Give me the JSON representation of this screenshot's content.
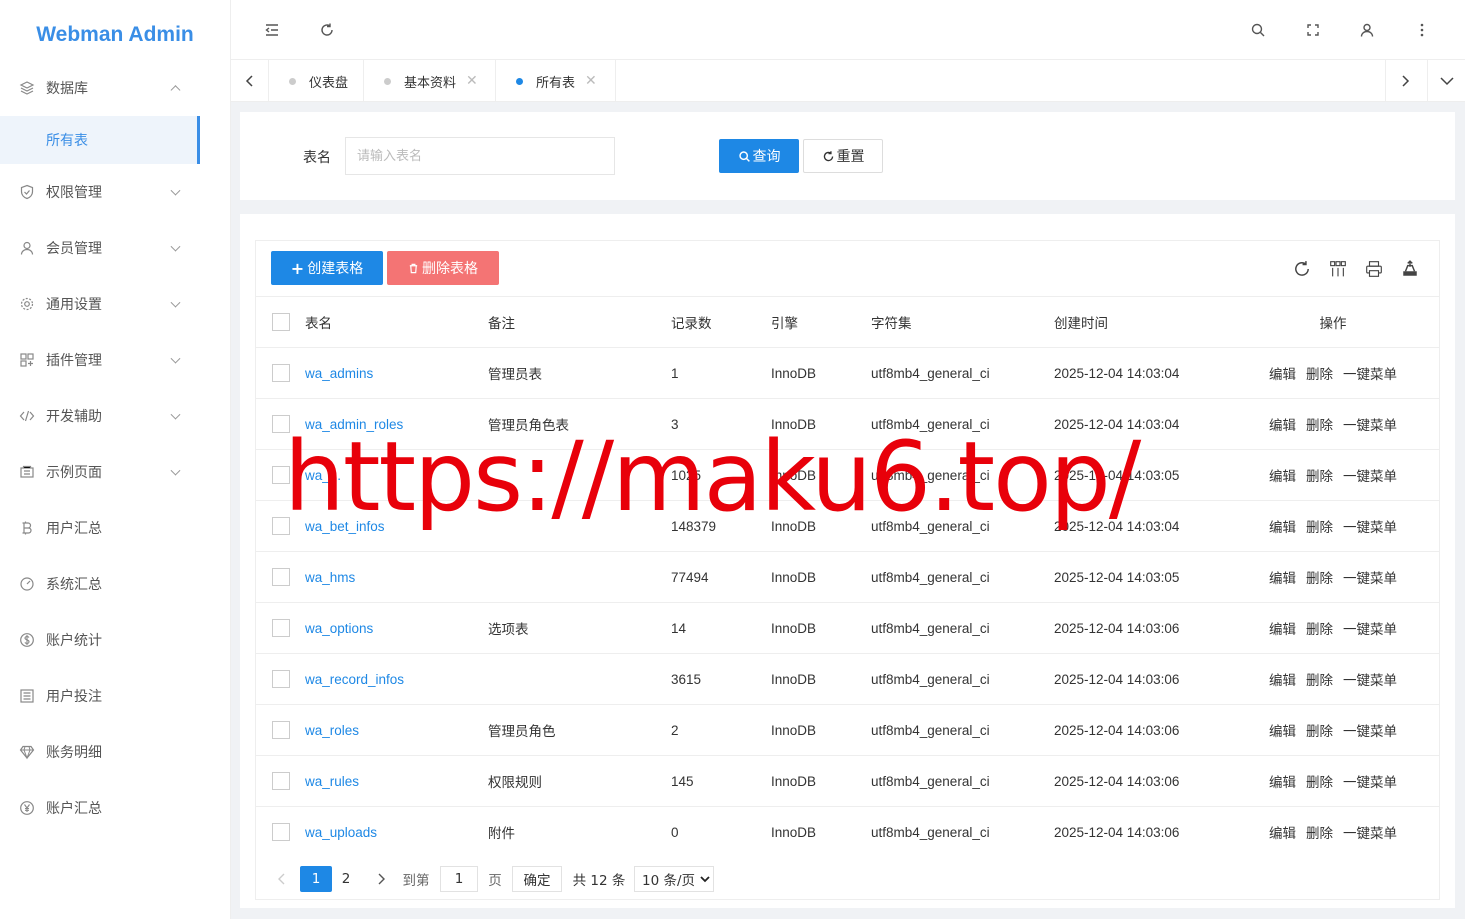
{
  "app": {
    "title": "Webman Admin"
  },
  "sidebar": {
    "items": [
      {
        "label": "数据库",
        "icon": "layers-icon",
        "expanded": true
      },
      {
        "label": "所有表",
        "icon": "",
        "sub": true,
        "active": true
      },
      {
        "label": "权限管理",
        "icon": "shield-icon"
      },
      {
        "label": "会员管理",
        "icon": "user-icon"
      },
      {
        "label": "通用设置",
        "icon": "gear-icon"
      },
      {
        "label": "插件管理",
        "icon": "apps-icon"
      },
      {
        "label": "开发辅助",
        "icon": "code-icon"
      },
      {
        "label": "示例页面",
        "icon": "page-icon"
      },
      {
        "label": "用户汇总",
        "icon": "bitcoin-icon"
      },
      {
        "label": "系统汇总",
        "icon": "dashboard-icon"
      },
      {
        "label": "账户统计",
        "icon": "dollar-icon"
      },
      {
        "label": "用户投注",
        "icon": "list-icon"
      },
      {
        "label": "账务明细",
        "icon": "diamond-icon"
      },
      {
        "label": "账户汇总",
        "icon": "yen-icon"
      }
    ]
  },
  "tabs": [
    {
      "label": "仪表盘",
      "closable": false,
      "active": false
    },
    {
      "label": "基本资料",
      "closable": true,
      "active": false
    },
    {
      "label": "所有表",
      "closable": true,
      "active": true
    }
  ],
  "search": {
    "label": "表名",
    "placeholder": "请输入表名",
    "query_button": "查询",
    "reset_button": "重置"
  },
  "toolbar": {
    "create_button": "创建表格",
    "delete_button": "删除表格"
  },
  "table": {
    "columns": [
      "表名",
      "备注",
      "记录数",
      "引擎",
      "字符集",
      "创建时间",
      "操作"
    ],
    "rows": [
      {
        "name": "wa_admins",
        "remark": "管理员表",
        "count": "1",
        "engine": "InnoDB",
        "charset": "utf8mb4_general_ci",
        "created": "2025-12-04 14:03:04"
      },
      {
        "name": "wa_admin_roles",
        "remark": "管理员角色表",
        "count": "3",
        "engine": "InnoDB",
        "charset": "utf8mb4_general_ci",
        "created": "2025-12-04 14:03:04"
      },
      {
        "name": "wa_...",
        "remark": "",
        "count": "1025",
        "engine": "InnoDB",
        "charset": "utf8mb4_general_ci",
        "created": "2025-12-04 14:03:05"
      },
      {
        "name": "wa_bet_infos",
        "remark": "",
        "count": "148379",
        "engine": "InnoDB",
        "charset": "utf8mb4_general_ci",
        "created": "2025-12-04 14:03:04"
      },
      {
        "name": "wa_hms",
        "remark": "",
        "count": "77494",
        "engine": "InnoDB",
        "charset": "utf8mb4_general_ci",
        "created": "2025-12-04 14:03:05"
      },
      {
        "name": "wa_options",
        "remark": "选项表",
        "count": "14",
        "engine": "InnoDB",
        "charset": "utf8mb4_general_ci",
        "created": "2025-12-04 14:03:06"
      },
      {
        "name": "wa_record_infos",
        "remark": "",
        "count": "3615",
        "engine": "InnoDB",
        "charset": "utf8mb4_general_ci",
        "created": "2025-12-04 14:03:06"
      },
      {
        "name": "wa_roles",
        "remark": "管理员角色",
        "count": "2",
        "engine": "InnoDB",
        "charset": "utf8mb4_general_ci",
        "created": "2025-12-04 14:03:06"
      },
      {
        "name": "wa_rules",
        "remark": "权限规则",
        "count": "145",
        "engine": "InnoDB",
        "charset": "utf8mb4_general_ci",
        "created": "2025-12-04 14:03:06"
      },
      {
        "name": "wa_uploads",
        "remark": "附件",
        "count": "0",
        "engine": "InnoDB",
        "charset": "utf8mb4_general_ci",
        "created": "2025-12-04 14:03:06"
      }
    ],
    "ops": [
      "编辑",
      "删除",
      "一键菜单"
    ]
  },
  "pagination": {
    "current": "1",
    "next_page": "2",
    "goto_label": "到第",
    "goto_value": "1",
    "page_unit": "页",
    "confirm": "确定",
    "total": "共 12 条",
    "page_size": "10 条/页"
  },
  "watermark": "https://maku6.top/",
  "colors": {
    "primary": "#1e88e5",
    "danger": "#f47474",
    "watermark": "#e8000a"
  }
}
